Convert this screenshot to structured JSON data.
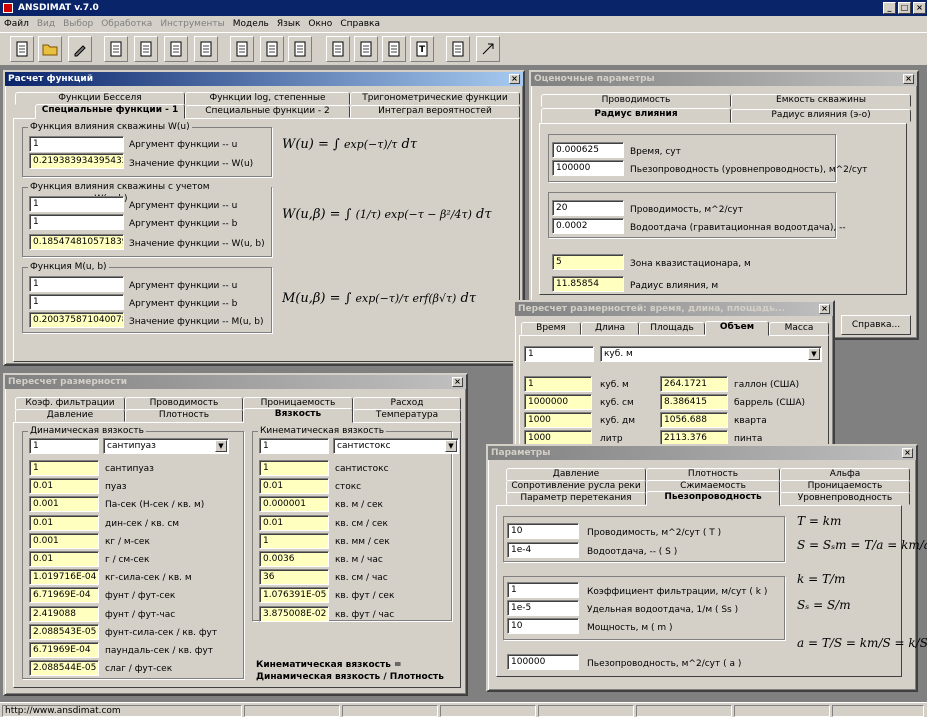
{
  "app": {
    "title": "ANSDIMAT v.7.0",
    "status_url": "http://www.ansdimat.com"
  },
  "menu": {
    "items": [
      "Файл",
      "Вид",
      "Выбор",
      "Обработка",
      "Инструменты",
      "Модель",
      "Язык",
      "Окно",
      "Справка"
    ],
    "disabled": [
      "Вид",
      "Выбор",
      "Обработка",
      "Инструменты"
    ]
  },
  "toolbar": {
    "buttons": [
      "new-file-icon",
      "open-folder-icon",
      "edit-icon",
      "document-icon",
      "document-icon",
      "document-icon",
      "document-icon",
      "document-icon",
      "document-icon",
      "document-icon",
      "document-icon",
      "document-icon",
      "document-icon",
      "text-icon",
      "document-icon",
      "maximize-icon",
      "minimize-icon"
    ]
  },
  "func_win": {
    "title": "Расчет функций",
    "tabs_row1": [
      "Функции Бесселя",
      "Функции log, степенные",
      "Тригонометрические функции"
    ],
    "tabs_row2": [
      "Специальные функции - 1",
      "Специальные функции - 2",
      "Интеграл вероятностей"
    ],
    "g1": {
      "title": "Функция влияния скважины W(u)",
      "u": "1",
      "u_label": "Аргумент функции -- u",
      "result": "0.219383934395432",
      "result_label": "Значение функции -- W(u)"
    },
    "g2": {
      "title": "Функция влияния скважины с учетом перетекания W(u, b)",
      "u": "1",
      "u_label": "Аргумент функции -- u",
      "b": "1",
      "b_label": "Аргумент функции -- b",
      "result": "0.185474810571839",
      "result_label": "Значение функции -- W(u, b)"
    },
    "g3": {
      "title": "Функция M(u, b)",
      "u": "1",
      "u_label": "Аргумент функции -- u",
      "b": "1",
      "b_label": "Аргумент функции -- b",
      "result": "0.200375871040078",
      "result_label": "Значение функции -- M(u, b)"
    }
  },
  "est_win": {
    "title": "Оценочные параметры",
    "tabs_row1": [
      "Проводимость",
      "Емкость скважины"
    ],
    "tabs_row2": [
      "Радиус влияния",
      "Радиус влияния (э-о)"
    ],
    "time": "0.000625",
    "time_label": "Время, сут",
    "piezo": "100000",
    "piezo_label": "Пьезопроводность (уровнепроводность), м^2/сут",
    "trans": "20",
    "trans_label": "Проводимость, м^2/сут",
    "yield": "0.0002",
    "yield_label": "Водоотдача (гравитационная водоотдача), --",
    "zone": "5",
    "zone_label": "Зона квазистационара, м",
    "radius": "11.85854",
    "radius_label": "Радиус влияния, м",
    "help_button": "Справка..."
  },
  "conv_win": {
    "title": "Пересчет размерностей: время, длина, площадь...",
    "tabs": [
      "Время",
      "Длина",
      "Площадь",
      "Объем",
      "Масса"
    ],
    "input": "1",
    "unit": "куб. м",
    "rows": [
      {
        "a": "1",
        "al": "куб. м",
        "b": "264.1721",
        "bl": "галлон (США)"
      },
      {
        "a": "1000000",
        "al": "куб. см",
        "b": "8.386415",
        "bl": "баррель (США)"
      },
      {
        "a": "1000",
        "al": "куб. дм",
        "b": "1056.688",
        "bl": "кварта"
      },
      {
        "a": "1000",
        "al": "литр",
        "b": "2113.376",
        "bl": "пинта"
      }
    ]
  },
  "dim_win": {
    "title": "Пересчет размерности",
    "tabs_row1": [
      "Коэф. фильтрации",
      "Проводимость",
      "Проницаемость",
      "Расход"
    ],
    "tabs_row2": [
      "Давление",
      "Плотность",
      "Вязкость",
      "Температура"
    ],
    "dyn": {
      "title": "Динамическая вязкость",
      "input": "1",
      "unit": "сантипуаз",
      "rows": [
        {
          "v": "1",
          "l": "сантипуаз"
        },
        {
          "v": "0.01",
          "l": "пуаз"
        },
        {
          "v": "0.001",
          "l": "Па-сек  (Н-сек / кв. м)"
        },
        {
          "v": "0.01",
          "l": "дин-сек / кв. см"
        },
        {
          "v": "0.001",
          "l": "кг / м-сек"
        },
        {
          "v": "0.01",
          "l": "г / см-сек"
        },
        {
          "v": "1.019716E-04",
          "l": "кг-сила-сек / кв. м"
        },
        {
          "v": "6.71969E-04",
          "l": "фунт / фут-сек"
        },
        {
          "v": "2.419088",
          "l": "фунт / фут-час"
        },
        {
          "v": "2.088543E-05",
          "l": "фунт-сила-сек / кв. фут"
        },
        {
          "v": "6.71969E-04",
          "l": "паундаль-сек / кв. фут"
        },
        {
          "v": "2.088544E-05",
          "l": "слаг / фут-сек"
        }
      ]
    },
    "kin": {
      "title": "Кинематическая вязкость",
      "input": "1",
      "unit": "сантистокс",
      "rows": [
        {
          "v": "1",
          "l": "сантистокс"
        },
        {
          "v": "0.01",
          "l": "стокс"
        },
        {
          "v": "0.000001",
          "l": "кв. м / сек"
        },
        {
          "v": "0.01",
          "l": "кв. см / сек"
        },
        {
          "v": "1",
          "l": "кв. мм / сек"
        },
        {
          "v": "0.0036",
          "l": "кв. м / час"
        },
        {
          "v": "36",
          "l": "кв. см / час"
        },
        {
          "v": "1.076391E-05",
          "l": "кв. фут / сек"
        },
        {
          "v": "3.875008E-02",
          "l": "кв. фут / час"
        }
      ]
    },
    "note1": "Кинематическая вязкость  =",
    "note2": "Динамическая вязкость  /  Плотность"
  },
  "param_win": {
    "title": "Параметры",
    "tabs_row1": [
      "Давление",
      "Плотность",
      "Альфа"
    ],
    "tabs_row2": [
      "Сопротивление русла реки",
      "Сжимаемость",
      "Проницаемость"
    ],
    "tabs_row3": [
      "Параметр перетекания",
      "Пьезопроводность",
      "Уровнепроводность"
    ],
    "g1": {
      "t": "10",
      "t_label": "Проводимость, м^2/сут  ( T )",
      "s": "1e-4",
      "s_label": "Водоотдача, --  ( S )"
    },
    "g2": {
      "k": "1",
      "k_label": "Коэффициент фильтрации, м/сут  ( k )",
      "ss": "1e-5",
      "ss_label": "Удельная водоотдача, 1/м  ( Ss )",
      "m": "10",
      "m_label": "Мощность, м  ( m )"
    },
    "a": "100000",
    "a_label": "Пьезопроводность, м^2/сут  ( a )"
  },
  "colors": {
    "title_active": "#0a246a",
    "title_inactive": "#808080",
    "result_bg": "#ffffc0"
  }
}
